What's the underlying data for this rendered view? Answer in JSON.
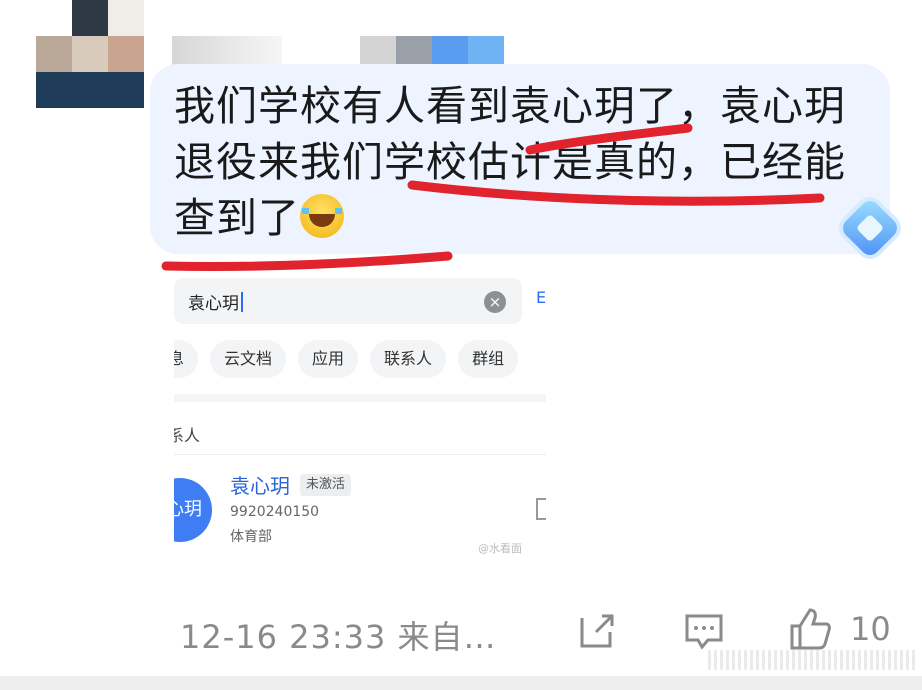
{
  "post": {
    "message_line1": "我们学校有人看到袁心玥了，袁心玥",
    "message_line2": "退役来我们学校估计是真的，已经能",
    "message_line3": "查到了",
    "emoji_icon": "laughing-crying-emoji-icon",
    "badge_icon": "blue-diamond-icon"
  },
  "screenshot": {
    "search_value": "袁心玥",
    "search_left_cut": ",",
    "right_edge_cut": "E",
    "chips": [
      "息",
      "云文档",
      "应用",
      "联系人",
      "群组"
    ],
    "section_label": "系人",
    "contact": {
      "avatar_text": "心玥",
      "name": "袁心玥",
      "status_badge": "未激活",
      "id": "9920240150",
      "department": "体育部"
    },
    "watermark": "@水看面"
  },
  "footer": {
    "timestamp": "12-16 23:33",
    "source": "来自…",
    "like_count": "10",
    "icons": [
      "share-icon",
      "comment-icon",
      "thumbs-up-icon"
    ]
  },
  "colors": {
    "bubble_bg": "#eef4ff",
    "highlight_stroke": "#e0232c",
    "link_blue": "#2b64d8",
    "meta_gray": "#8a8a8a"
  }
}
